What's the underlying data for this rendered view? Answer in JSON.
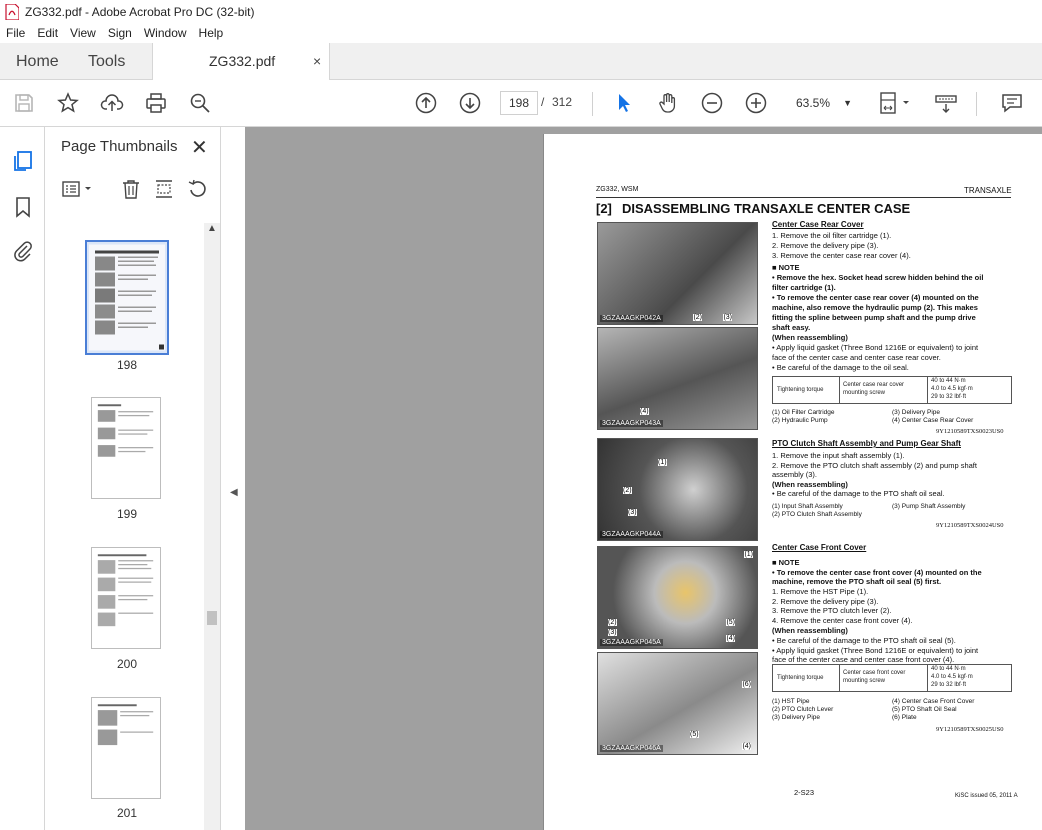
{
  "window": {
    "title": "ZG332.pdf - Adobe Acrobat Pro DC (32-bit)"
  },
  "menu": [
    "File",
    "Edit",
    "View",
    "Sign",
    "Window",
    "Help"
  ],
  "tabs": {
    "home": "Home",
    "tools": "Tools",
    "document": "ZG332.pdf",
    "close": "×"
  },
  "toolbar": {
    "current_page": "198",
    "page_sep": "/",
    "total_pages": "312",
    "zoom": "63.5%"
  },
  "panel": {
    "title": "Page Thumbnails",
    "close": "✕",
    "thumbnails": [
      {
        "label": "198",
        "selected": true
      },
      {
        "label": "199",
        "selected": false
      },
      {
        "label": "200",
        "selected": false
      },
      {
        "label": "201",
        "selected": false
      }
    ]
  },
  "colors": {
    "accent": "#1473e6",
    "selection": "#4a7ed6"
  },
  "pdf_page": {
    "header_left": "ZG332, WSM",
    "header_right": "TRANSAXLE",
    "section_number": "[2]",
    "section_title": "DISASSEMBLING TRANSAXLE CENTER CASE",
    "rear_cover": {
      "heading": "Center Case Rear Cover",
      "steps": [
        "1.  Remove the oil filter cartridge (1).",
        "2.  Remove the delivery pipe (3).",
        "3.  Remove the center case rear cover (4)."
      ],
      "note_label": "■  NOTE",
      "notes": [
        "•  Remove the hex. Socket head screw hidden behind the oil",
        "   filter cartridge (1).",
        "•  To remove the center case rear cover (4) mounted on the",
        "   machine, also remove the hydraulic pump (2). This makes",
        "   fitting the spline between pump shaft and the pump drive",
        "   shaft easy."
      ],
      "reassembling_label": "(When reassembling)",
      "reassembling": [
        "•  Apply liquid gasket (Three Bond 1216E or equivalent) to joint",
        "   face of the center case and center case rear cover.",
        "•  Be careful of the damage to the oil seal."
      ],
      "torque_label": "Tightening torque",
      "torque_item": [
        "Center case rear cover",
        "mounting screw"
      ],
      "torque_values": [
        "40 to 44 N·m",
        "4.0 to 4.5 kgf·m",
        "29 to 32 lbf·ft"
      ],
      "legend_left": [
        "(1)  Oil Filter Cartridge",
        "(2)  Hydraulic Pump"
      ],
      "legend_right": [
        "(3)  Delivery Pipe",
        "(4)  Center Case Rear Cover"
      ],
      "code": "9Y1210589TXS0023US0"
    },
    "pto": {
      "heading": "PTO Clutch Shaft Assembly and Pump Gear Shaft",
      "steps": [
        "1.  Remove the input shaft assembly (1).",
        "2.  Remove the PTO clutch shaft assembly (2) and pump shaft",
        "     assembly (3)."
      ],
      "reassembling_label": "(When reassembling)",
      "reassembling": [
        "•  Be careful of the damage to the PTO shaft oil seal."
      ],
      "legend_left": [
        "(1)  Input Shaft Assembly",
        "(2)  PTO Clutch Shaft Assembly"
      ],
      "legend_right": [
        "(3)  Pump Shaft Assembly"
      ],
      "code": "9Y1210589TXS0024US0"
    },
    "front_cover": {
      "heading": "Center Case Front Cover",
      "note_label": "■  NOTE",
      "notes": [
        "•  To remove the center case front cover (4) mounted on the",
        "   machine, remove the PTO shaft oil seal (5) first."
      ],
      "steps": [
        "1.  Remove the HST Pipe (1).",
        "2.  Remove the delivery pipe (3).",
        "3.  Remove the PTO clutch lever (2).",
        "4.  Remove the center case front cover (4)."
      ],
      "reassembling_label": "(When reassembling)",
      "reassembling": [
        "•  Be careful of the damage to the PTO shaft oil seal (5).",
        "•  Apply liquid gasket (Three Bond 1216E or equivalent) to joint",
        "   face of the center case and center case front cover (4)."
      ],
      "torque_label": "Tightening torque",
      "torque_item": [
        "Center case front cover",
        "mounting screw"
      ],
      "torque_values": [
        "40 to 44 N·m",
        "4.0 to 4.5 kgf·m",
        "29 to 32 lbf·ft"
      ],
      "legend_left": [
        "(1)  HST Pipe",
        "(2)  PTO Clutch Lever",
        "(3)  Delivery Pipe"
      ],
      "legend_right": [
        "(4)  Center Case Front Cover",
        "(5)  PTO Shaft Oil Seal",
        "(6)  Plate"
      ],
      "code": "9Y1210589TXS0025US0"
    },
    "photos": [
      {
        "caption": "3GZAAAGKP042A",
        "labels": [
          "(2)",
          "(3)"
        ]
      },
      {
        "caption": "3GZAAAGKP043A",
        "labels": [
          "(4)"
        ]
      },
      {
        "caption": "3GZAAAGKP044A",
        "labels": [
          "(1)",
          "(2)",
          "(3)"
        ]
      },
      {
        "caption": "3GZAAAGKP045A",
        "labels": [
          "(1)",
          "(2)",
          "(3)",
          "(4)",
          "(5)"
        ]
      },
      {
        "caption": "3GZAAAGKP046A",
        "labels": [
          "(6)",
          "(5)",
          "(4)"
        ]
      }
    ],
    "footer_page": "2-S23",
    "footer_right": "KiSC issued 05, 2011 A"
  }
}
